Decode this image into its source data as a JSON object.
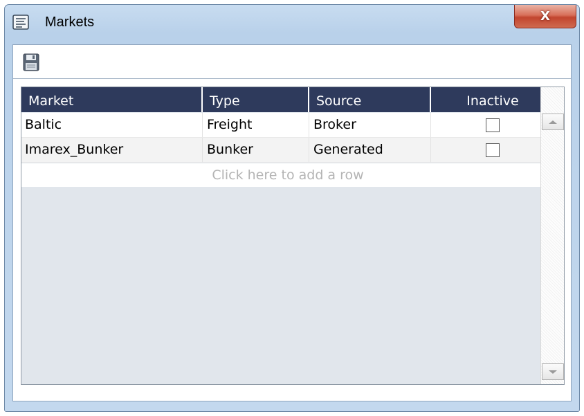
{
  "window": {
    "title": "Markets",
    "close_label": "X",
    "icons": {
      "app": "document-list-icon",
      "close": "close-icon"
    }
  },
  "toolbar": {
    "save_icon": "floppy-disk-icon"
  },
  "grid": {
    "columns": [
      {
        "label": "Market"
      },
      {
        "label": "Type"
      },
      {
        "label": "Source"
      },
      {
        "label": "Inactive"
      }
    ],
    "rows": [
      {
        "market": "Baltic",
        "type": "Freight",
        "source": "Broker",
        "inactive": false
      },
      {
        "market": "Imarex_Bunker",
        "type": "Bunker",
        "source": "Generated",
        "inactive": false
      }
    ],
    "add_row_text": "Click here to add a row"
  },
  "colors": {
    "header_bg": "#2e3a5c",
    "title_bar": "#c3d8ee",
    "close_button": "#c2452f"
  }
}
